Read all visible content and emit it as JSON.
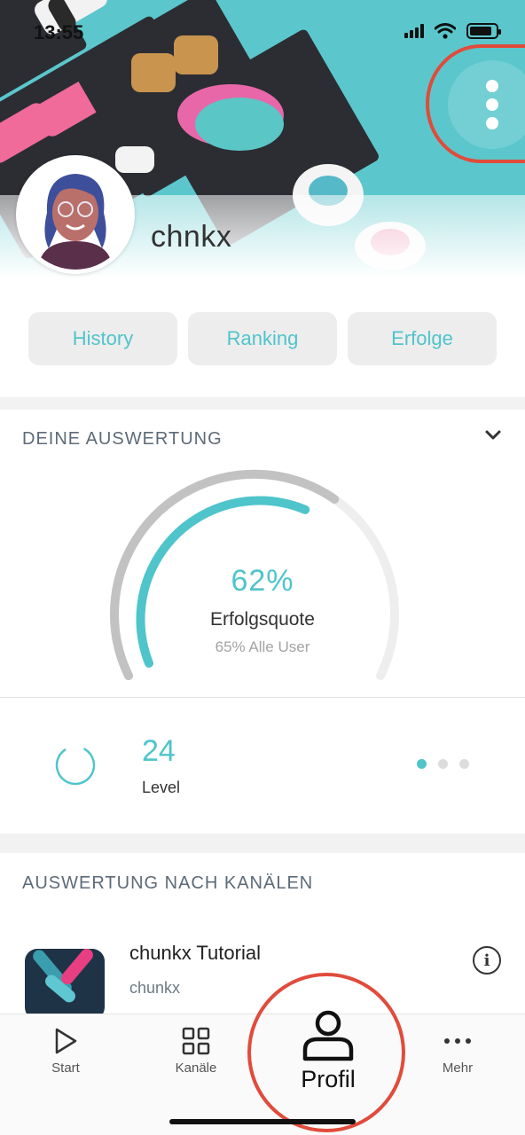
{
  "status_bar": {
    "time": "13:55"
  },
  "profile": {
    "username": "chnkx"
  },
  "tabs_row": {
    "history": "History",
    "ranking": "Ranking",
    "erfolge": "Erfolge"
  },
  "evaluation": {
    "title": "DEINE AUSWERTUNG",
    "success_rate": "62%",
    "success_rate_label": "Erfolgsquote",
    "all_users": "65% Alle User",
    "success_rate_value": 0.62,
    "all_users_value": 0.65,
    "level_value": "24",
    "level_label": "Level",
    "level_progress": 0.82,
    "carousel_pages": 3,
    "carousel_active": 0
  },
  "channels": {
    "title": "AUSWERTUNG NACH KANÄLEN",
    "items": [
      {
        "name": "chunkx Tutorial",
        "author": "chunkx"
      }
    ]
  },
  "tabbar": {
    "start": "Start",
    "kanaele": "Kanäle",
    "profil": "Profil",
    "mehr": "Mehr"
  },
  "colors": {
    "accent": "#4fc4cb",
    "header_bg": "#5bc7cc",
    "highlight_ring": "#e14b3b"
  }
}
